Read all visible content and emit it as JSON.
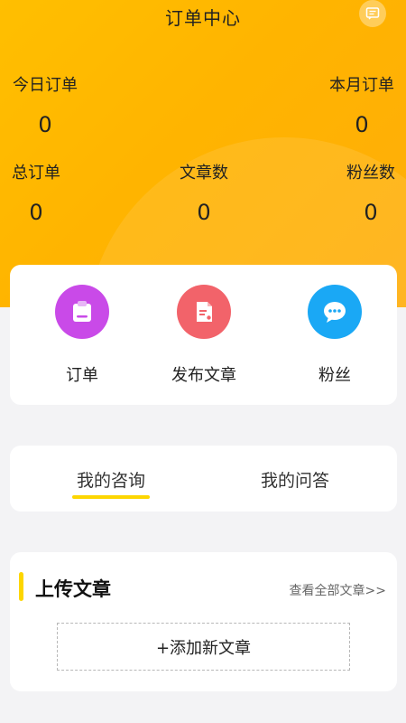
{
  "header": {
    "title": "订单中心"
  },
  "stats": {
    "today_orders": {
      "label": "今日订单",
      "value": "0"
    },
    "month_orders": {
      "label": "本月订单",
      "value": "0"
    },
    "total_orders": {
      "label": "总订单",
      "value": "0"
    },
    "articles": {
      "label": "文章数",
      "value": "0"
    },
    "fans": {
      "label": "粉丝数",
      "value": "0"
    }
  },
  "quick_actions": [
    {
      "label": "订单",
      "icon": "clipboard-icon",
      "color": "#c94ae8"
    },
    {
      "label": "发布文章",
      "icon": "document-icon",
      "color": "#f2636a"
    },
    {
      "label": "粉丝",
      "icon": "chat-bubble-icon",
      "color": "#1aa8f5"
    }
  ],
  "tabs": [
    {
      "label": "我的咨询",
      "active": true
    },
    {
      "label": "我的问答",
      "active": false
    }
  ],
  "articles_section": {
    "title": "上传文章",
    "view_all": "查看全部文章>>",
    "add_button": "+添加新文章"
  },
  "colors": {
    "accent": "#fdd600",
    "hero": "#ffb400"
  }
}
